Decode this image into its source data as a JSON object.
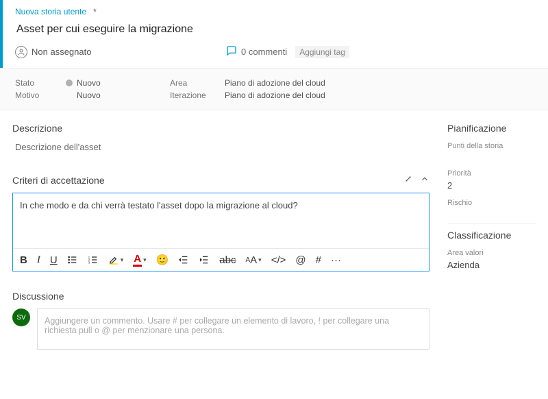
{
  "type_label": "Nuova storia utente",
  "changed_marker": "*",
  "title": "Asset per cui eseguire la migrazione",
  "assignee": {
    "label": "Non assegnato"
  },
  "comments_label": "0 commenti",
  "add_tags_label": "Aggiungi tag",
  "fields": {
    "stato_label": "Stato",
    "stato_value": "Nuovo",
    "motivo_label": "Motivo",
    "motivo_value": "Nuovo",
    "area_label": "Area",
    "area_value": "Piano di adozione del cloud",
    "iterazione_label": "Iterazione",
    "iterazione_value": "Piano di adozione del cloud"
  },
  "sections": {
    "descrizione_h": "Descrizione",
    "descrizione_text": "Descrizione dell'asset",
    "criteri_h": "Criteri di accettazione",
    "criteri_text": "In che modo e da chi verrà testato l'asset dopo la migrazione al cloud?",
    "discussione_h": "Discussione"
  },
  "sidebar": {
    "pianificazione_h": "Pianificazione",
    "punti_label": "Punti della storia",
    "priorita_label": "Priorità",
    "priorita_value": "2",
    "rischio_label": "Rischio",
    "classificazione_h": "Classificazione",
    "area_valori_label": "Area valori",
    "area_valori_value": "Azienda"
  },
  "discussion": {
    "avatar_initials": "SV",
    "placeholder_main": "Aggiungere un commento. Usare # per collegare un elemento di lavoro, ! per collegare una richiesta pull o @ per menzionare una persona."
  },
  "toolbar": {
    "bold": "B",
    "italic": "I",
    "underline": "U",
    "emoji": "🙂",
    "strike": "abc",
    "fontsize": "A",
    "code": "</>",
    "mention": "@",
    "hash": "#",
    "more": "···"
  }
}
